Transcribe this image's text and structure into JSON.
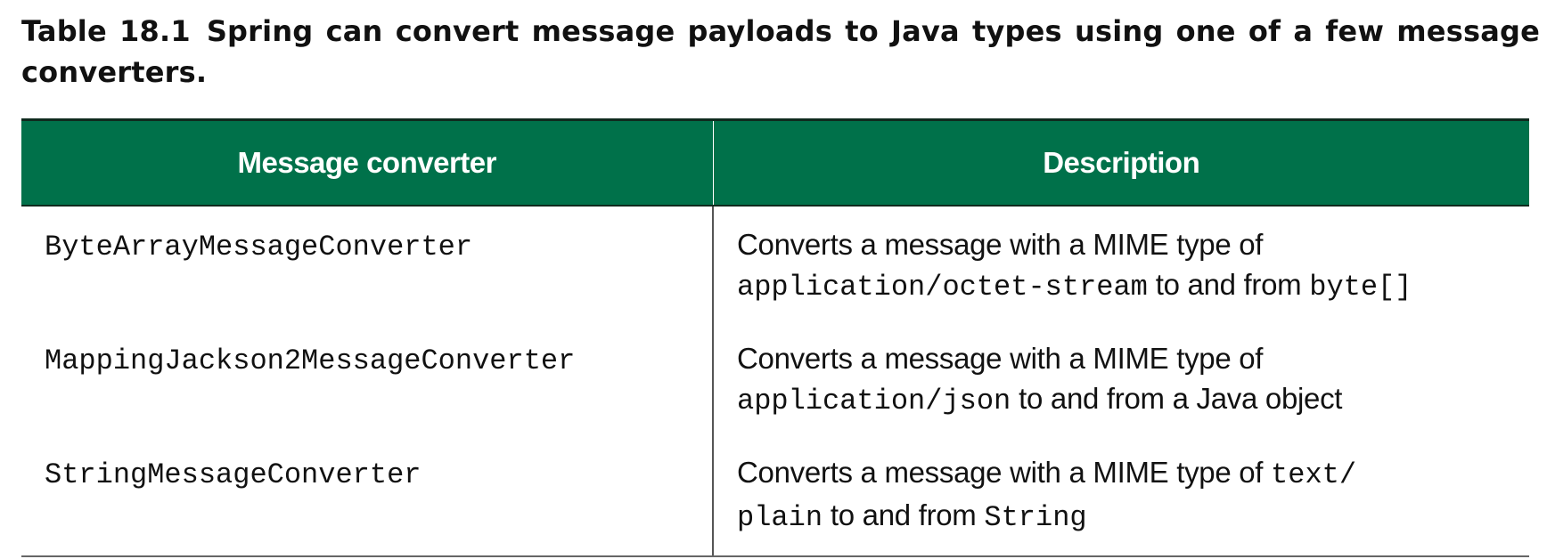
{
  "caption": {
    "label": "Table 18.1",
    "text": "Spring can convert message payloads to Java types using one of a few message converters."
  },
  "table": {
    "headers": [
      "Message converter",
      "Description"
    ],
    "rows": [
      {
        "name": "ByteArrayMessageConverter",
        "desc": {
          "lead": "Converts a message with a MIME type of",
          "code1": "application/octet-stream",
          "mid": " to and from ",
          "code2": "byte[]",
          "tail": ""
        }
      },
      {
        "name": "MappingJackson2MessageConverter",
        "desc": {
          "lead": "Converts a message with a MIME type of",
          "code1": "application/json",
          "mid": " to and from a Java object",
          "code2": "",
          "tail": ""
        }
      },
      {
        "name": "StringMessageConverter",
        "desc": {
          "lead": "Converts a message with a MIME type of ",
          "code1": "text/",
          "code1b": "plain",
          "mid": " to and from ",
          "code2": "String"
        }
      }
    ]
  }
}
